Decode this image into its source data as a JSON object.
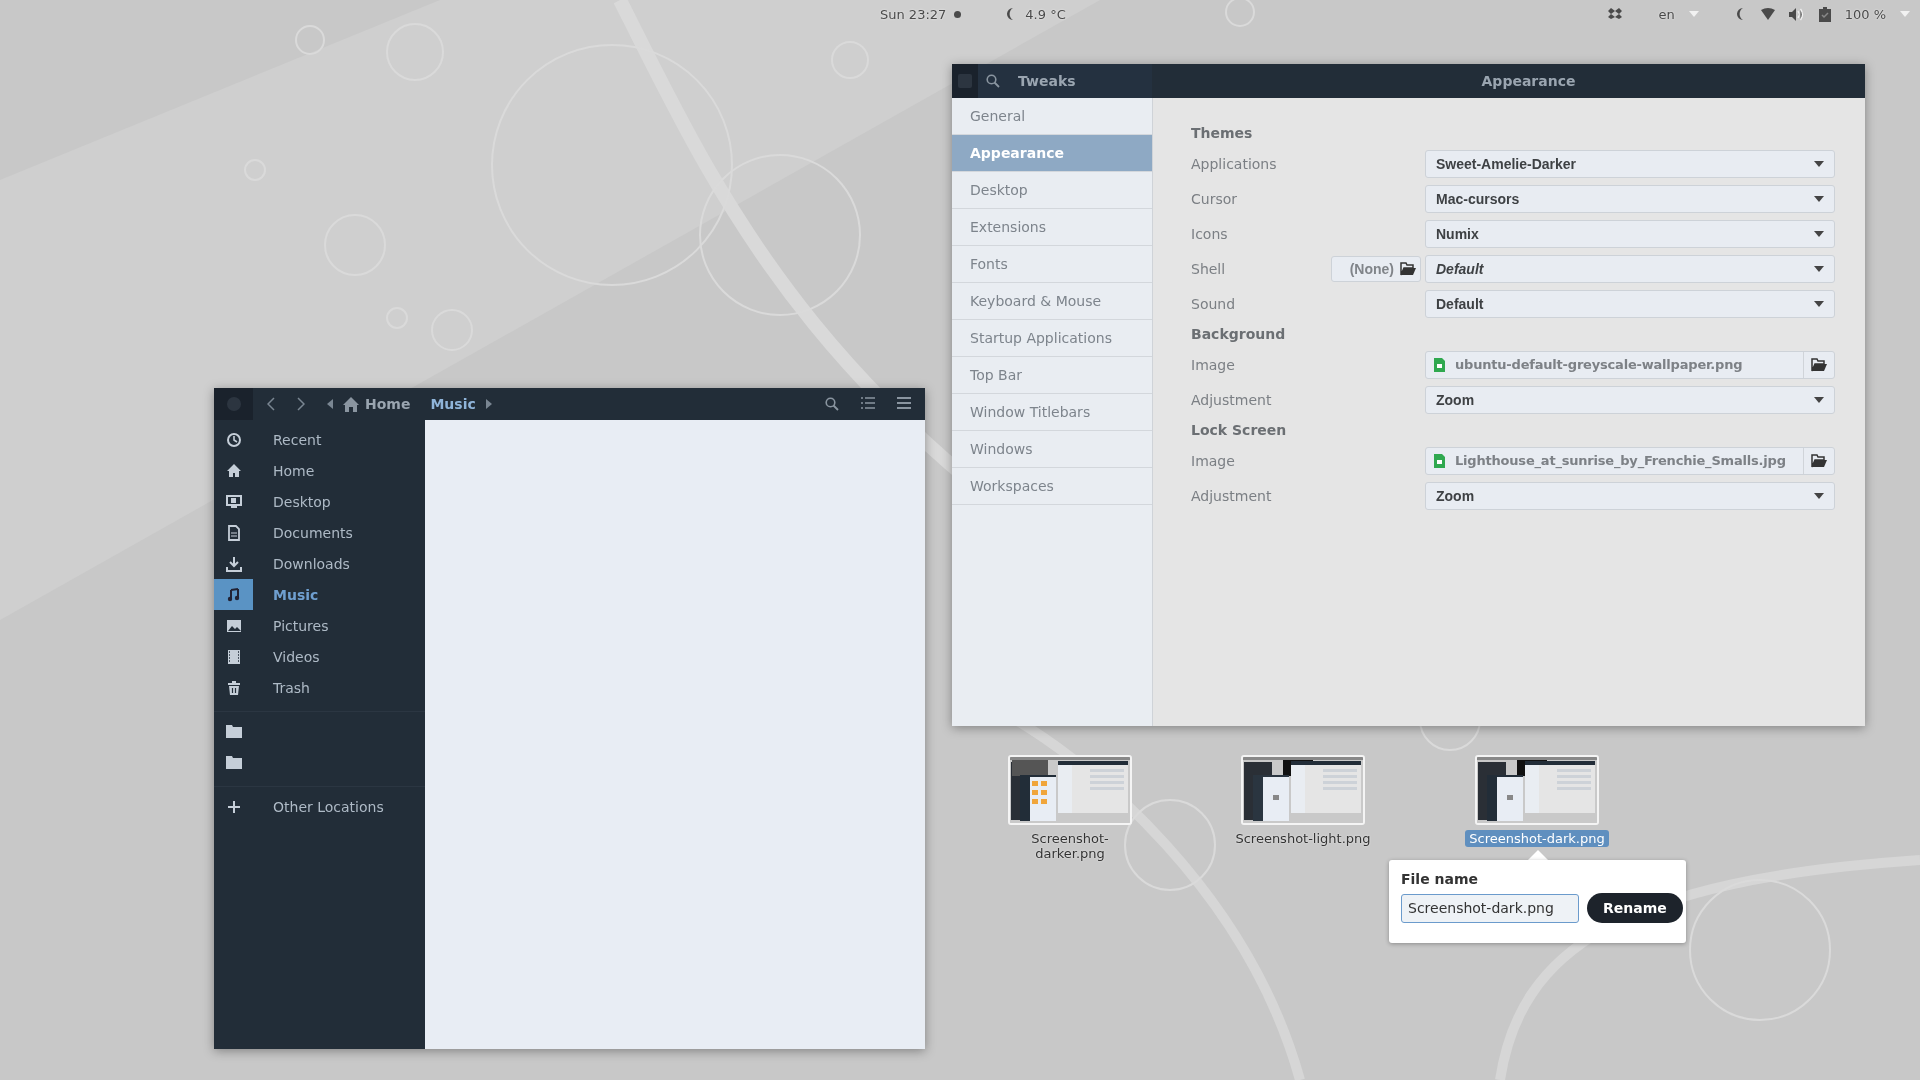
{
  "top_bar": {
    "clock": "Sun 23:27",
    "weather": "4.9 °C",
    "keyboard": "en",
    "battery": "100 %"
  },
  "tweaks": {
    "title": "Tweaks",
    "page_title": "Appearance",
    "sidebar": [
      {
        "label": "General",
        "selected": false
      },
      {
        "label": "Appearance",
        "selected": true
      },
      {
        "label": "Desktop",
        "selected": false
      },
      {
        "label": "Extensions",
        "selected": false
      },
      {
        "label": "Fonts",
        "selected": false
      },
      {
        "label": "Keyboard & Mouse",
        "selected": false
      },
      {
        "label": "Startup Applications",
        "selected": false
      },
      {
        "label": "Top Bar",
        "selected": false
      },
      {
        "label": "Window Titlebars",
        "selected": false
      },
      {
        "label": "Windows",
        "selected": false
      },
      {
        "label": "Workspaces",
        "selected": false
      }
    ],
    "sections": [
      {
        "heading": "Themes",
        "rows": [
          {
            "label": "Applications",
            "kind": "dropdown",
            "value": "Sweet-Amelie-Darker",
            "italic": false
          },
          {
            "label": "Cursor",
            "kind": "dropdown",
            "value": "Mac-cursors",
            "italic": false
          },
          {
            "label": "Icons",
            "kind": "dropdown",
            "value": "Numix",
            "italic": false
          },
          {
            "label": "Shell",
            "kind": "dropdown",
            "value": "Default",
            "italic": true,
            "extension_button": "(None)"
          },
          {
            "label": "Sound",
            "kind": "dropdown",
            "value": "Default",
            "italic": false
          }
        ]
      },
      {
        "heading": "Background",
        "rows": [
          {
            "label": "Image",
            "kind": "file",
            "value": "ubuntu-default-greyscale-wallpaper.png",
            "italic": false
          },
          {
            "label": "Adjustment",
            "kind": "dropdown",
            "value": "Zoom",
            "italic": false
          }
        ]
      },
      {
        "heading": "Lock Screen",
        "rows": [
          {
            "label": "Image",
            "kind": "file",
            "value": "Lighthouse_at_sunrise_by_Frenchie_Smalls.jpg",
            "italic": false
          },
          {
            "label": "Adjustment",
            "kind": "dropdown",
            "value": "Zoom",
            "italic": false
          }
        ]
      }
    ]
  },
  "files": {
    "path": [
      {
        "label": "Home",
        "selected": false
      },
      {
        "label": "Music",
        "selected": true
      }
    ],
    "places": [
      {
        "label": "Recent",
        "selected": false
      },
      {
        "label": "Home",
        "selected": false
      },
      {
        "label": "Desktop",
        "selected": false
      },
      {
        "label": "Documents",
        "selected": false
      },
      {
        "label": "Downloads",
        "selected": false
      },
      {
        "label": "Music",
        "selected": true
      },
      {
        "label": "Pictures",
        "selected": false
      },
      {
        "label": "Videos",
        "selected": false
      },
      {
        "label": "Trash",
        "selected": false
      }
    ],
    "other_locations": "Other Locations"
  },
  "desktop_files": [
    {
      "name": "Screenshot-darker.png",
      "selected": false
    },
    {
      "name": "Screenshot-light.png",
      "selected": false
    },
    {
      "name": "Screenshot-dark.png",
      "selected": true
    }
  ],
  "rename_popover": {
    "heading": "File name",
    "value": "Screenshot-dark.png",
    "button": "Rename"
  }
}
